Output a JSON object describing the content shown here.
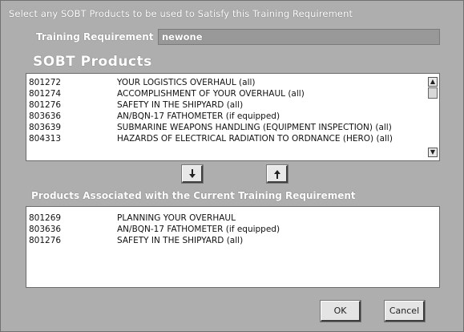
{
  "window": {
    "title": "Select any SOBT Products to be used to Satisfy this Training Requirement"
  },
  "training_requirement": {
    "label": "Training Requirement",
    "value": "newone"
  },
  "sobt_products": {
    "heading": "SOBT Products",
    "items": [
      {
        "code": "801272",
        "name": "YOUR LOGISTICS OVERHAUL  (all)"
      },
      {
        "code": "801274",
        "name": "ACCOMPLISHMENT OF YOUR OVERHAUL  (all)"
      },
      {
        "code": "801276",
        "name": "SAFETY IN THE SHIPYARD  (all)"
      },
      {
        "code": "803636",
        "name": "AN/BQN-17 FATHOMETER  (if equipped)"
      },
      {
        "code": "803639",
        "name": "SUBMARINE WEAPONS HANDLING (EQUIPMENT INSPECTION)  (all)"
      },
      {
        "code": "804313",
        "name": "HAZARDS OF ELECTRICAL RADIATION TO ORDNANCE (HERO)  (all)"
      }
    ]
  },
  "associated_products": {
    "heading": "Products Associated with the Current Training Requirement",
    "items": [
      {
        "code": "801269",
        "name": "PLANNING YOUR OVERHAUL"
      },
      {
        "code": "803636",
        "name": "AN/BQN-17 FATHOMETER  (if equipped)"
      },
      {
        "code": "801276",
        "name": "SAFETY IN THE SHIPYARD  (all)"
      }
    ]
  },
  "icons": {
    "add": "arrow-down-icon",
    "remove": "arrow-up-icon"
  },
  "buttons": {
    "ok": "OK",
    "cancel": "Cancel"
  }
}
